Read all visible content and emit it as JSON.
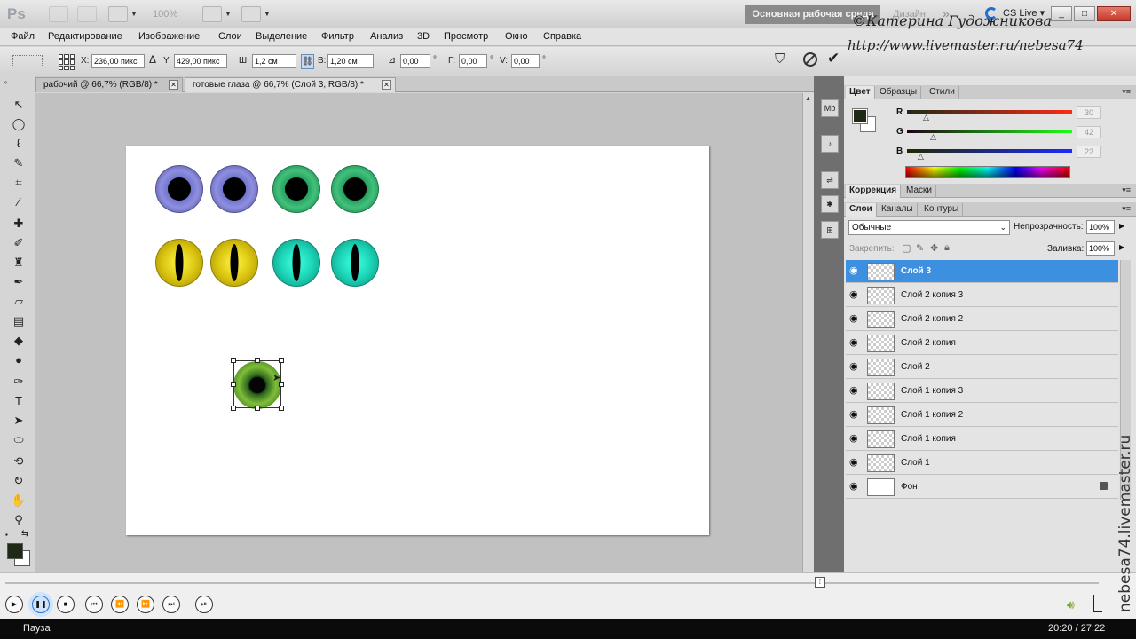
{
  "titlebar": {
    "app_logo": "Ps",
    "zoom": "100%",
    "workspace": "Основная рабочая среда",
    "design": "Дизайн",
    "more": "»",
    "cs_live": "CS Live ▾",
    "minimize": "_",
    "maximize": "□",
    "close": "✕"
  },
  "watermark": {
    "author": "©Катерина Гудожникова",
    "url": "http://www.livemaster.ru/nebesa74",
    "side": "nebesa74.livemaster.ru"
  },
  "menubar": {
    "items": [
      "Файл",
      "Редактирование",
      "Изображение",
      "Слои",
      "Выделение",
      "Фильтр",
      "Анализ",
      "3D",
      "Просмотр",
      "Окно",
      "Справка"
    ]
  },
  "options": {
    "x_label": "X:",
    "x_value": "236,00 пикс",
    "delta": "Δ",
    "y_label": "Y:",
    "y_value": "429,00 пикс",
    "w_label": "Ш:",
    "w_value": "1,2 см",
    "h_label": "В:",
    "h_value": "1,20 см",
    "angle_label": "⊿",
    "angle_value": "0,00",
    "angle_unit": "°",
    "hskew_label": "Г:",
    "hskew_value": "0,00",
    "hskew_unit": "°",
    "vskew_label": "V:",
    "vskew_value": "0,00",
    "vskew_unit": "°"
  },
  "doctabs": [
    {
      "title": "рабочий @ 66,7% (RGB/8) *",
      "close": "✕"
    },
    {
      "title": "готовые глаза @ 66,7% (Слой 3, RGB/8) *",
      "close": "✕"
    }
  ],
  "color_panel": {
    "tabs": [
      "Цвет",
      "Образцы",
      "Стили"
    ],
    "r_label": "R",
    "r_value": "30",
    "g_label": "G",
    "g_value": "42",
    "b_label": "B",
    "b_value": "22",
    "foreground": "#1e2a16",
    "background": "#ffffff"
  },
  "adjust_panel": {
    "tabs": [
      "Коррекция",
      "Маски"
    ]
  },
  "layers_panel": {
    "tabs": [
      "Слои",
      "Каналы",
      "Контуры"
    ],
    "blend_mode": "Обычные",
    "opacity_label": "Непрозрачность:",
    "opacity_value": "100%",
    "lock_label": "Закрепить:",
    "fill_label": "Заливка:",
    "fill_value": "100%",
    "layers": [
      {
        "name": "Слой 3",
        "selected": true,
        "locked": false
      },
      {
        "name": "Слой 2 копия 3",
        "selected": false,
        "locked": false
      },
      {
        "name": "Слой 2 копия 2",
        "selected": false,
        "locked": false
      },
      {
        "name": "Слой 2 копия",
        "selected": false,
        "locked": false
      },
      {
        "name": "Слой 2",
        "selected": false,
        "locked": false
      },
      {
        "name": "Слой 1 копия 3",
        "selected": false,
        "locked": false
      },
      {
        "name": "Слой 1 копия 2",
        "selected": false,
        "locked": false
      },
      {
        "name": "Слой 1 копия",
        "selected": false,
        "locked": false
      },
      {
        "name": "Слой 1",
        "selected": false,
        "locked": false
      },
      {
        "name": "Фон",
        "selected": false,
        "locked": true
      }
    ]
  },
  "player": {
    "status": "Пауза",
    "time": "20:20 / 27:22",
    "progress": 0.745
  }
}
